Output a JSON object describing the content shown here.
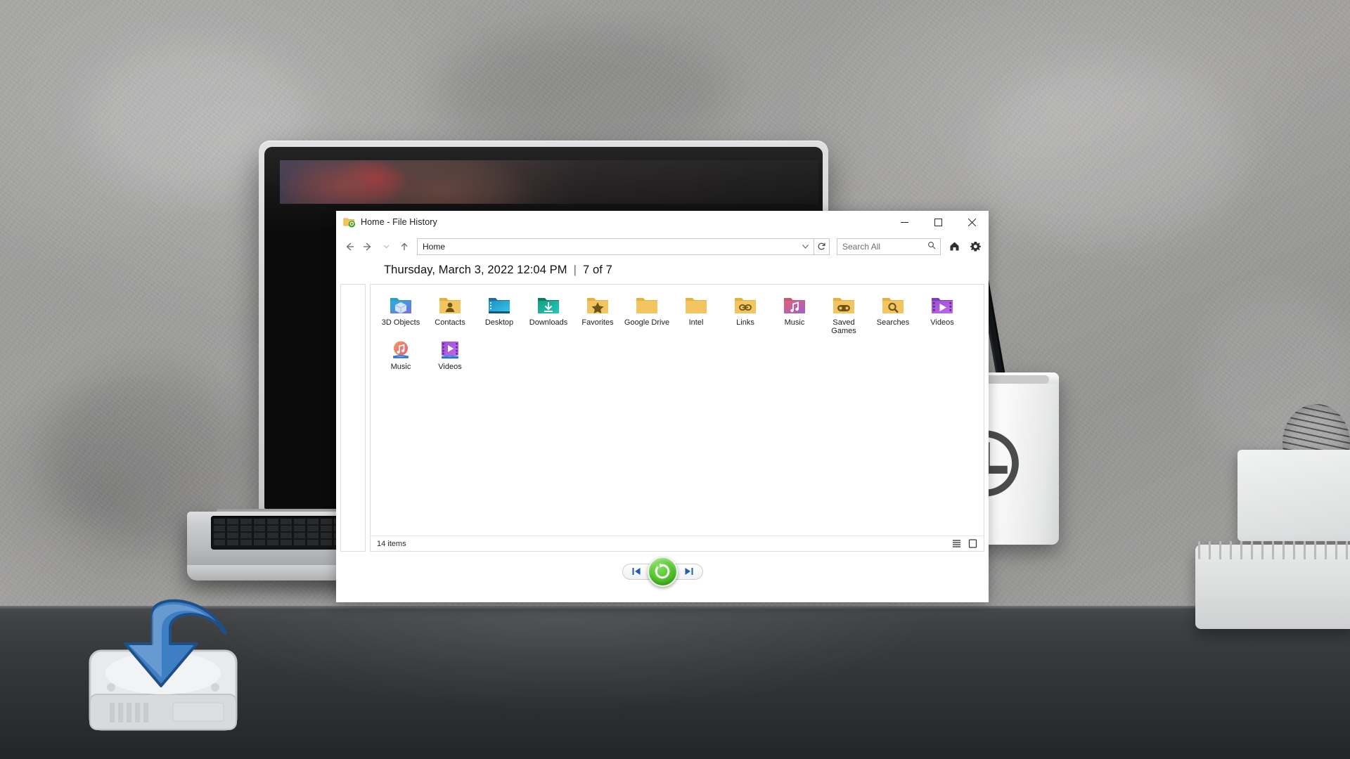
{
  "window": {
    "title": "Home - File History",
    "title_icon": "file-history-icon",
    "controls": {
      "minimize": "—",
      "maximize": "□",
      "close": "✕"
    }
  },
  "toolbar": {
    "back_icon": "←",
    "forward_icon": "→",
    "recent_icon": "˅",
    "up_icon": "↑",
    "address_value": "Home",
    "address_chevron": "⌄",
    "refresh_icon": "↻",
    "search_placeholder": "Search All",
    "search_icon": "search-icon",
    "home_icon": "home-icon",
    "settings_icon": "gear-icon"
  },
  "header": {
    "datetime": "Thursday, March 3, 2022 12:04 PM",
    "separator": "|",
    "position": "7 of 7"
  },
  "items": [
    {
      "label": "3D Objects",
      "icon": "folder-3d-objects",
      "kind": "folder-3d"
    },
    {
      "label": "Contacts",
      "icon": "folder-contacts",
      "kind": "folder-contacts"
    },
    {
      "label": "Desktop",
      "icon": "folder-desktop",
      "kind": "folder-desktop"
    },
    {
      "label": "Downloads",
      "icon": "folder-downloads",
      "kind": "folder-downloads"
    },
    {
      "label": "Favorites",
      "icon": "folder-favorites",
      "kind": "folder-favorites"
    },
    {
      "label": "Google Drive",
      "icon": "folder-plain",
      "kind": "folder-plain"
    },
    {
      "label": "Intel",
      "icon": "folder-plain",
      "kind": "folder-plain"
    },
    {
      "label": "Links",
      "icon": "folder-links",
      "kind": "folder-links"
    },
    {
      "label": "Music",
      "icon": "folder-music",
      "kind": "folder-music"
    },
    {
      "label": "Saved Games",
      "icon": "folder-saved-games",
      "kind": "folder-games"
    },
    {
      "label": "Searches",
      "icon": "folder-searches",
      "kind": "folder-searches"
    },
    {
      "label": "Videos",
      "icon": "folder-videos",
      "kind": "folder-videos"
    },
    {
      "label": "Music",
      "icon": "library-music",
      "kind": "library-music"
    },
    {
      "label": "Videos",
      "icon": "library-videos",
      "kind": "library-videos"
    }
  ],
  "status": {
    "item_count": "14 items",
    "view_list_icon": "list-view-icon",
    "view_details_icon": "details-view-icon"
  },
  "footer": {
    "previous_icon": "⏮",
    "previous_name": "previous-version-button",
    "restore_icon": "restore-circular-arrow-icon",
    "restore_name": "restore-button",
    "next_icon": "⏭",
    "next_name": "next-version-button"
  },
  "scene": {
    "disk_overlay_icon": "backup-restore-disk-icon",
    "cup_icon": "history-clock-icon"
  },
  "colors": {
    "folder_yellow": "#f3c560",
    "folder_yellow_dark": "#e9b33f",
    "accent_blue": "#1d5fa8",
    "restore_green": "#3fae1a",
    "close_red": "#e81123",
    "text_primary": "#1c1c1c"
  }
}
